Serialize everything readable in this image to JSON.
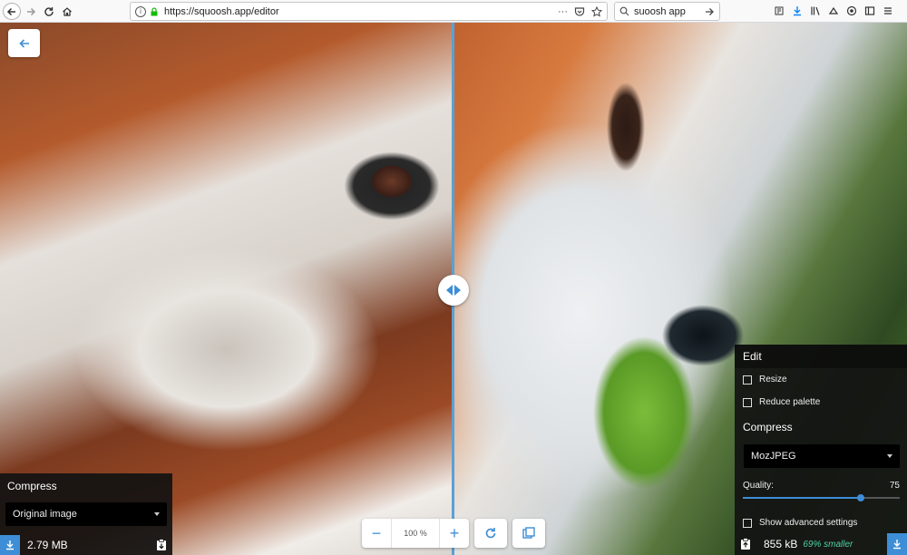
{
  "browser": {
    "url_prefix": "https://",
    "url_host": "squoosh.app/editor",
    "search_text": "suoosh app",
    "url_more": "···"
  },
  "app": {
    "back_icon": "arrow-left-icon",
    "left_panel": {
      "title": "Compress",
      "select_value": "Original image",
      "file_size": "2.79 MB"
    },
    "right_panel": {
      "edit_title": "Edit",
      "resize_label": "Resize",
      "reduce_palette_label": "Reduce palette",
      "compress_title": "Compress",
      "codec_value": "MozJPEG",
      "quality_label": "Quality:",
      "quality_value": "75",
      "quality_fraction": 0.75,
      "advanced_label": "Show advanced settings",
      "file_size": "855 kB",
      "savings": "69% smaller"
    },
    "zoom": {
      "minus": "−",
      "value": "100 %",
      "plus": "+"
    }
  },
  "colors": {
    "accent": "#3d8ed6",
    "savings": "#4fd1a4",
    "panel_bg": "#121212"
  }
}
